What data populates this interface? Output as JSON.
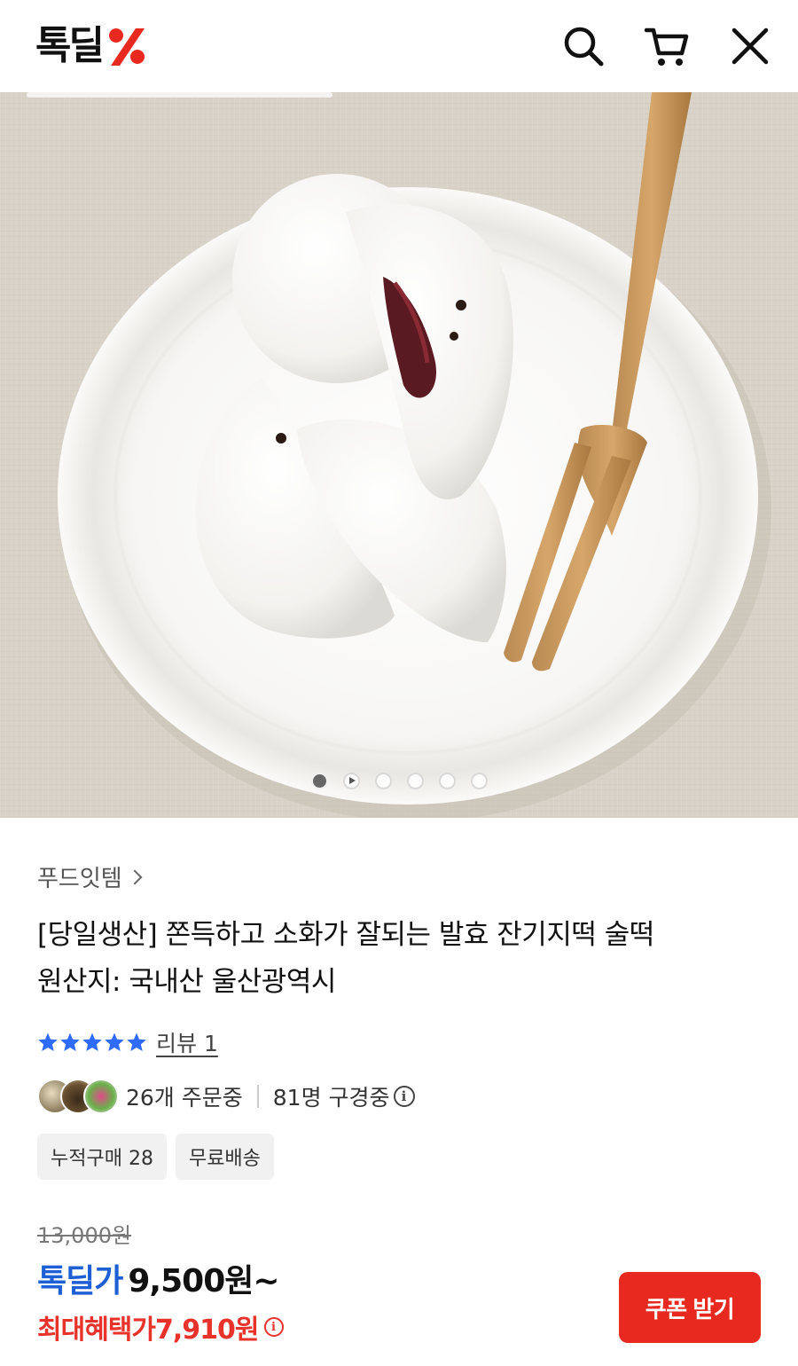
{
  "header": {
    "logo_text": "톡딜",
    "logo_symbol": "%",
    "icons": [
      "search-icon",
      "cart-icon",
      "close-icon"
    ]
  },
  "gallery": {
    "image_description": "white rice cakes with red bean filling on a white plate with a wooden fork",
    "slide_count": 6,
    "active_slide": 1,
    "video_slide": 2
  },
  "product": {
    "category": "푸드잇템",
    "title_line1": "[당일생산] 쫀득하고 소화가 잘되는 발효 잔기지떡 술떡",
    "title_line2": "원산지: 국내산 울산광역시",
    "rating": 5,
    "review_label": "리뷰 1",
    "orders_label": "26개 주문중",
    "viewers_label": "81명 구경중",
    "tags": [
      "누적구매 28",
      "무료배송"
    ],
    "original_price": "13,000원",
    "deal_label": "톡딜가",
    "deal_price": "9,500원~",
    "max_benefit_label": "최대혜택가",
    "max_benefit_price": "7,910원",
    "coupon_button": "쿠폰 받기"
  },
  "colors": {
    "brand_red": "#e8291f",
    "deal_blue": "#1f5fd6",
    "star_blue": "#2f6bff"
  }
}
